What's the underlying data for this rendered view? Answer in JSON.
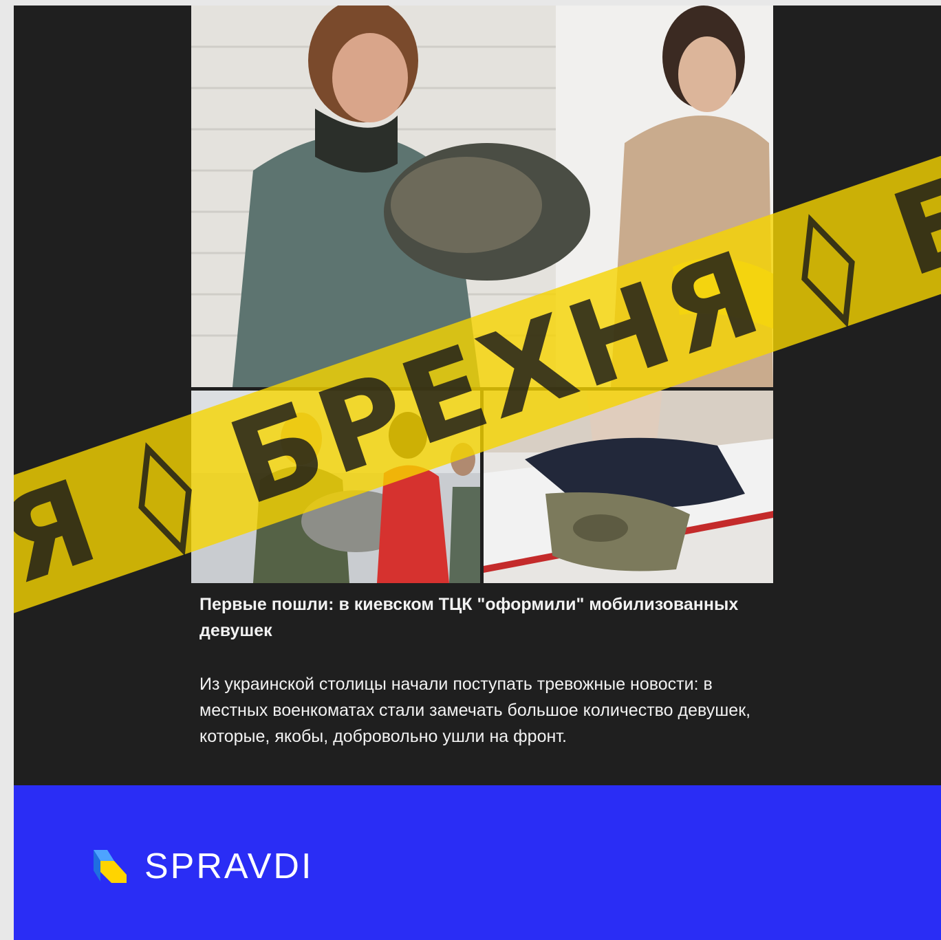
{
  "post": {
    "headline": "Первые пошли: в киевском ТЦК \"оформили\" мобилизованных девушек",
    "body": "Из украинской столицы начали поступать тревожные новости: в местных военкоматах стали замечать большое количество девушек, которые, якобы, добровольно ушли на фронт."
  },
  "stamp": {
    "text": "НЯ ◊ БРЕХНЯ ◊ БРЕ"
  },
  "brand": {
    "name": "SPRAVDI"
  },
  "colors": {
    "stamp_yellow": "#f6d400",
    "footer_blue": "#2a2df5",
    "post_background": "#1f1f1f"
  }
}
